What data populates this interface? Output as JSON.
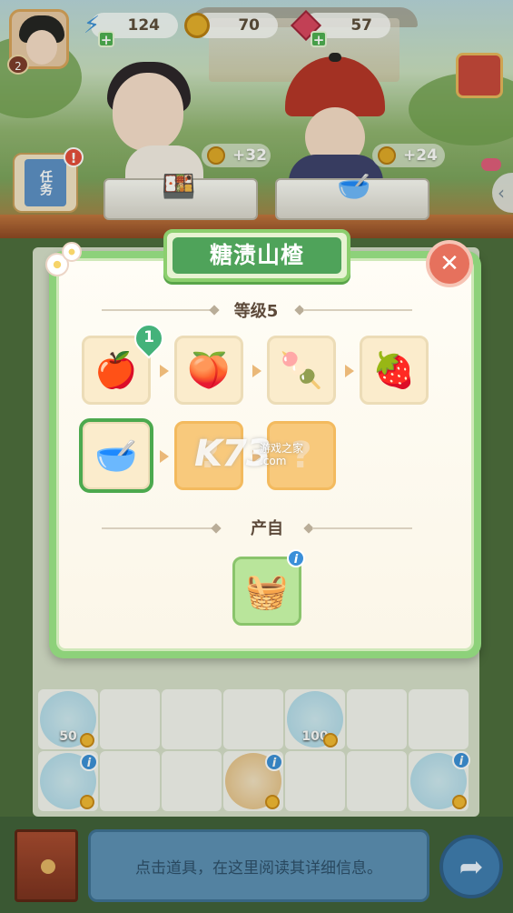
{
  "resources": {
    "player_level": "2",
    "energy": {
      "icon": "energy-bolt-icon",
      "value": "124"
    },
    "coins": {
      "icon": "coin-icon",
      "value": "70"
    },
    "gems": {
      "icon": "gem-icon",
      "value": "57"
    }
  },
  "scene": {
    "customer_1": {
      "reward": "+32",
      "dish_icon": "dish-tray-icon"
    },
    "customer_2": {
      "reward": "+24",
      "dish_icon": "soup-bowl-icon"
    },
    "task_label": "任务"
  },
  "modal": {
    "title": "糖渍山楂",
    "level_heading": "等级5",
    "source_heading": "产自",
    "chain_row1": [
      {
        "name": "hawthorn-icon",
        "emoji": "🍎"
      },
      {
        "name": "cut-hawthorn-icon",
        "emoji": "🍑"
      },
      {
        "name": "hawthorn-skewer-icon",
        "emoji": "🍡"
      },
      {
        "name": "candied-plate-icon",
        "emoji": "🍓"
      }
    ],
    "chain_row2": [
      {
        "name": "hawthorn-soup-bowl-icon",
        "emoji": "🥣"
      },
      {
        "name": "locked-slot",
        "emoji": "?"
      },
      {
        "name": "locked-slot",
        "emoji": "?"
      }
    ],
    "first_item_badge": "1",
    "source_item": {
      "name": "veggie-basket-icon",
      "emoji": "🧺"
    }
  },
  "watermark": {
    "brand": "K73",
    "line1": "游戏之家",
    "line2": ".com"
  },
  "board_items": [
    {
      "label": "50",
      "icon": "energy-bolt-icon"
    },
    {
      "label": "100",
      "icon": "energy-bolt-icon"
    }
  ],
  "bottom": {
    "info_text": "点击道具，在这里阅读其详细信息。"
  },
  "colors": {
    "accent_green": "#4fa35a",
    "modal_border": "#8dd17a",
    "close_red": "#e6715d",
    "locked_slot": "#f8c97c"
  }
}
